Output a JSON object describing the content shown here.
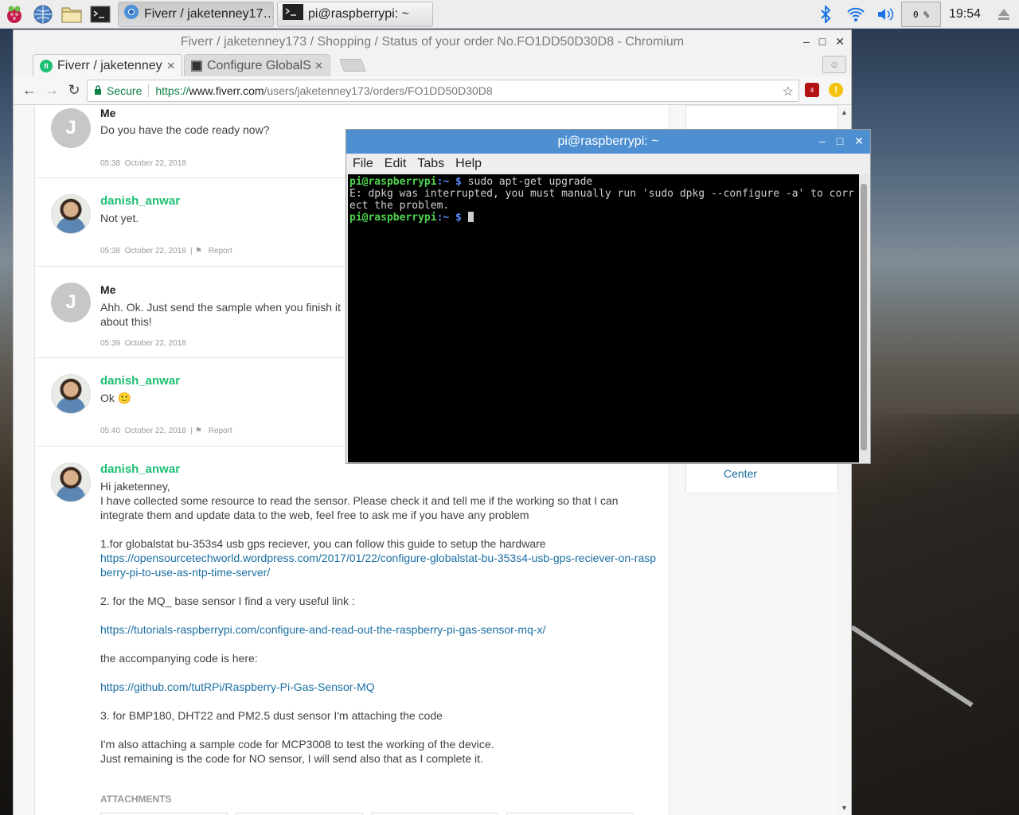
{
  "taskbar": {
    "tasks": [
      {
        "label": "Fiverr / jaketenney17…",
        "icon": "chromium-icon"
      },
      {
        "label": "pi@raspberrypi: ~",
        "icon": "terminal-icon"
      }
    ],
    "cpu": "0 %",
    "clock": "19:54"
  },
  "browser": {
    "window_title": "Fiverr / jaketenney173 / Shopping / Status of your order No.FO1DD50D30D8 - Chromium",
    "tabs": [
      {
        "label": "Fiverr / jaketenney"
      },
      {
        "label": "Configure GlobalS"
      }
    ],
    "secure_label": "Secure",
    "url_scheme": "https://",
    "url_host": "www.fiverr.com",
    "url_path": "/users/jaketenney173/orders/FO1DD50D30D8",
    "ext_badge": "4"
  },
  "messages": [
    {
      "sender": "Me",
      "avatar": "J",
      "text": "Do you have the code ready now?",
      "time": "05:38",
      "date": "October 22, 2018"
    },
    {
      "sender": "danish_anwar",
      "text": "Not yet.",
      "time": "05:38",
      "date": "October 22, 2018",
      "report": "Report"
    },
    {
      "sender": "Me",
      "avatar": "J",
      "text": "Ahh. Ok. Just send the sample when you finish it",
      "text2": "about this!",
      "time": "05:39",
      "date": "October 22, 2018"
    },
    {
      "sender": "danish_anwar",
      "text": "Ok 🙂",
      "time": "05:40",
      "date": "October 22, 2018",
      "report": "Report"
    },
    {
      "sender": "danish_anwar"
    }
  ],
  "long_message": {
    "l1": "Hi jaketenney,",
    "l2": "I have collected some resource to read the sensor. Please check it and tell me if the working so that I can integrate them and update data to the web, feel free to ask me if you have any problem",
    "l3": "1.for globalstat bu-353s4 usb gps reciever, you can follow this guide to setup the hardware",
    "link1": "https://opensourcetechworld.wordpress.com/2017/01/22/configure-globalstat-bu-353s4-usb-gps-reciever-on-raspberry-pi-to-use-as-ntp-time-server/",
    "l4": "2. for the MQ_ base sensor I find a very useful link :",
    "link2": "https://tutorials-raspberrypi.com/configure-and-read-out-the-raspberry-pi-gas-sensor-mq-x/",
    "l5": "the accompanying code is here:",
    "link3": "https://github.com/tutRPi/Raspberry-Pi-Gas-Sensor-MQ",
    "l6": "3. for BMP180, DHT22 and PM2.5 dust sensor I'm attaching the code",
    "l7": "I'm also attaching a sample code for MCP3008 to test the working of the device.",
    "l8": "Just remaining is the code for NO sensor, I will send also that as I complete it."
  },
  "attachments_label": "ATTACHMENTS",
  "sidebar_link": "Center",
  "terminal": {
    "title": "pi@raspberrypi: ~",
    "menu": [
      "File",
      "Edit",
      "Tabs",
      "Help"
    ],
    "prompt_user": "pi@raspberrypi",
    "prompt_path": ":~ $",
    "cmd1": " sudo apt-get upgrade",
    "output": "E: dpkg was interrupted, you must manually run 'sudo dpkg --configure -a' to correct the problem."
  }
}
